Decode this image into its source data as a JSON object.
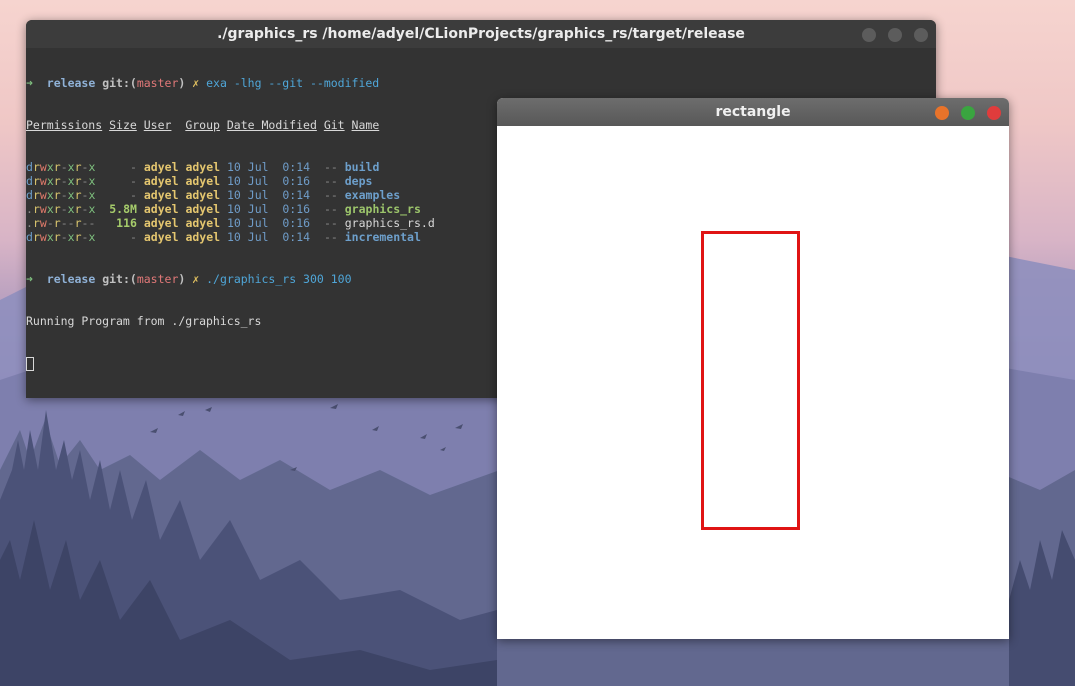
{
  "terminal": {
    "title": "./graphics_rs /home/adyel/CLionProjects/graphics_rs/target/release",
    "prompt1": {
      "arrow": "➜",
      "dir": "release",
      "git_prefix": "git:(",
      "branch": "master",
      "git_suffix": ")",
      "dirty": "✗",
      "command": "exa -lhg --git --modified"
    },
    "headers": [
      "Permissions",
      "Size",
      "User",
      "Group",
      "Date Modified",
      "Git",
      "Name"
    ],
    "rows": [
      {
        "perm": "drwxr-xr-x",
        "size": "-",
        "user": "adyel",
        "group": "adyel",
        "date": "10 Jul  0:14",
        "git": "--",
        "name": "build",
        "kind": "dir"
      },
      {
        "perm": "drwxr-xr-x",
        "size": "-",
        "user": "adyel",
        "group": "adyel",
        "date": "10 Jul  0:16",
        "git": "--",
        "name": "deps",
        "kind": "dir"
      },
      {
        "perm": "drwxr-xr-x",
        "size": "-",
        "user": "adyel",
        "group": "adyel",
        "date": "10 Jul  0:14",
        "git": "--",
        "name": "examples",
        "kind": "dir"
      },
      {
        "perm": ".rwxr-xr-x",
        "size": "5.8M",
        "user": "adyel",
        "group": "adyel",
        "date": "10 Jul  0:16",
        "git": "--",
        "name": "graphics_rs",
        "kind": "exe"
      },
      {
        "perm": ".rw-r--r--",
        "size": "116",
        "user": "adyel",
        "group": "adyel",
        "date": "10 Jul  0:16",
        "git": "--",
        "name": "graphics_rs.d",
        "kind": "file"
      },
      {
        "perm": "drwxr-xr-x",
        "size": "-",
        "user": "adyel",
        "group": "adyel",
        "date": "10 Jul  0:14",
        "git": "--",
        "name": "incremental",
        "kind": "dir"
      }
    ],
    "prompt2": {
      "arrow": "➜",
      "dir": "release",
      "git_prefix": "git:(",
      "branch": "master",
      "git_suffix": ")",
      "dirty": "✗",
      "command": "./graphics_rs 300 100"
    },
    "output": "Running Program from ./graphics_rs"
  },
  "rect_window": {
    "title": "rectangle",
    "buttons": {
      "minimize_color": "#e8732a",
      "maximize_color": "#3aa540",
      "close_color": "#e03c3c"
    },
    "shape": {
      "color": "#e01414"
    }
  },
  "desktop": {
    "wallpaper": "misty forest with mountains and birds at dusk"
  }
}
